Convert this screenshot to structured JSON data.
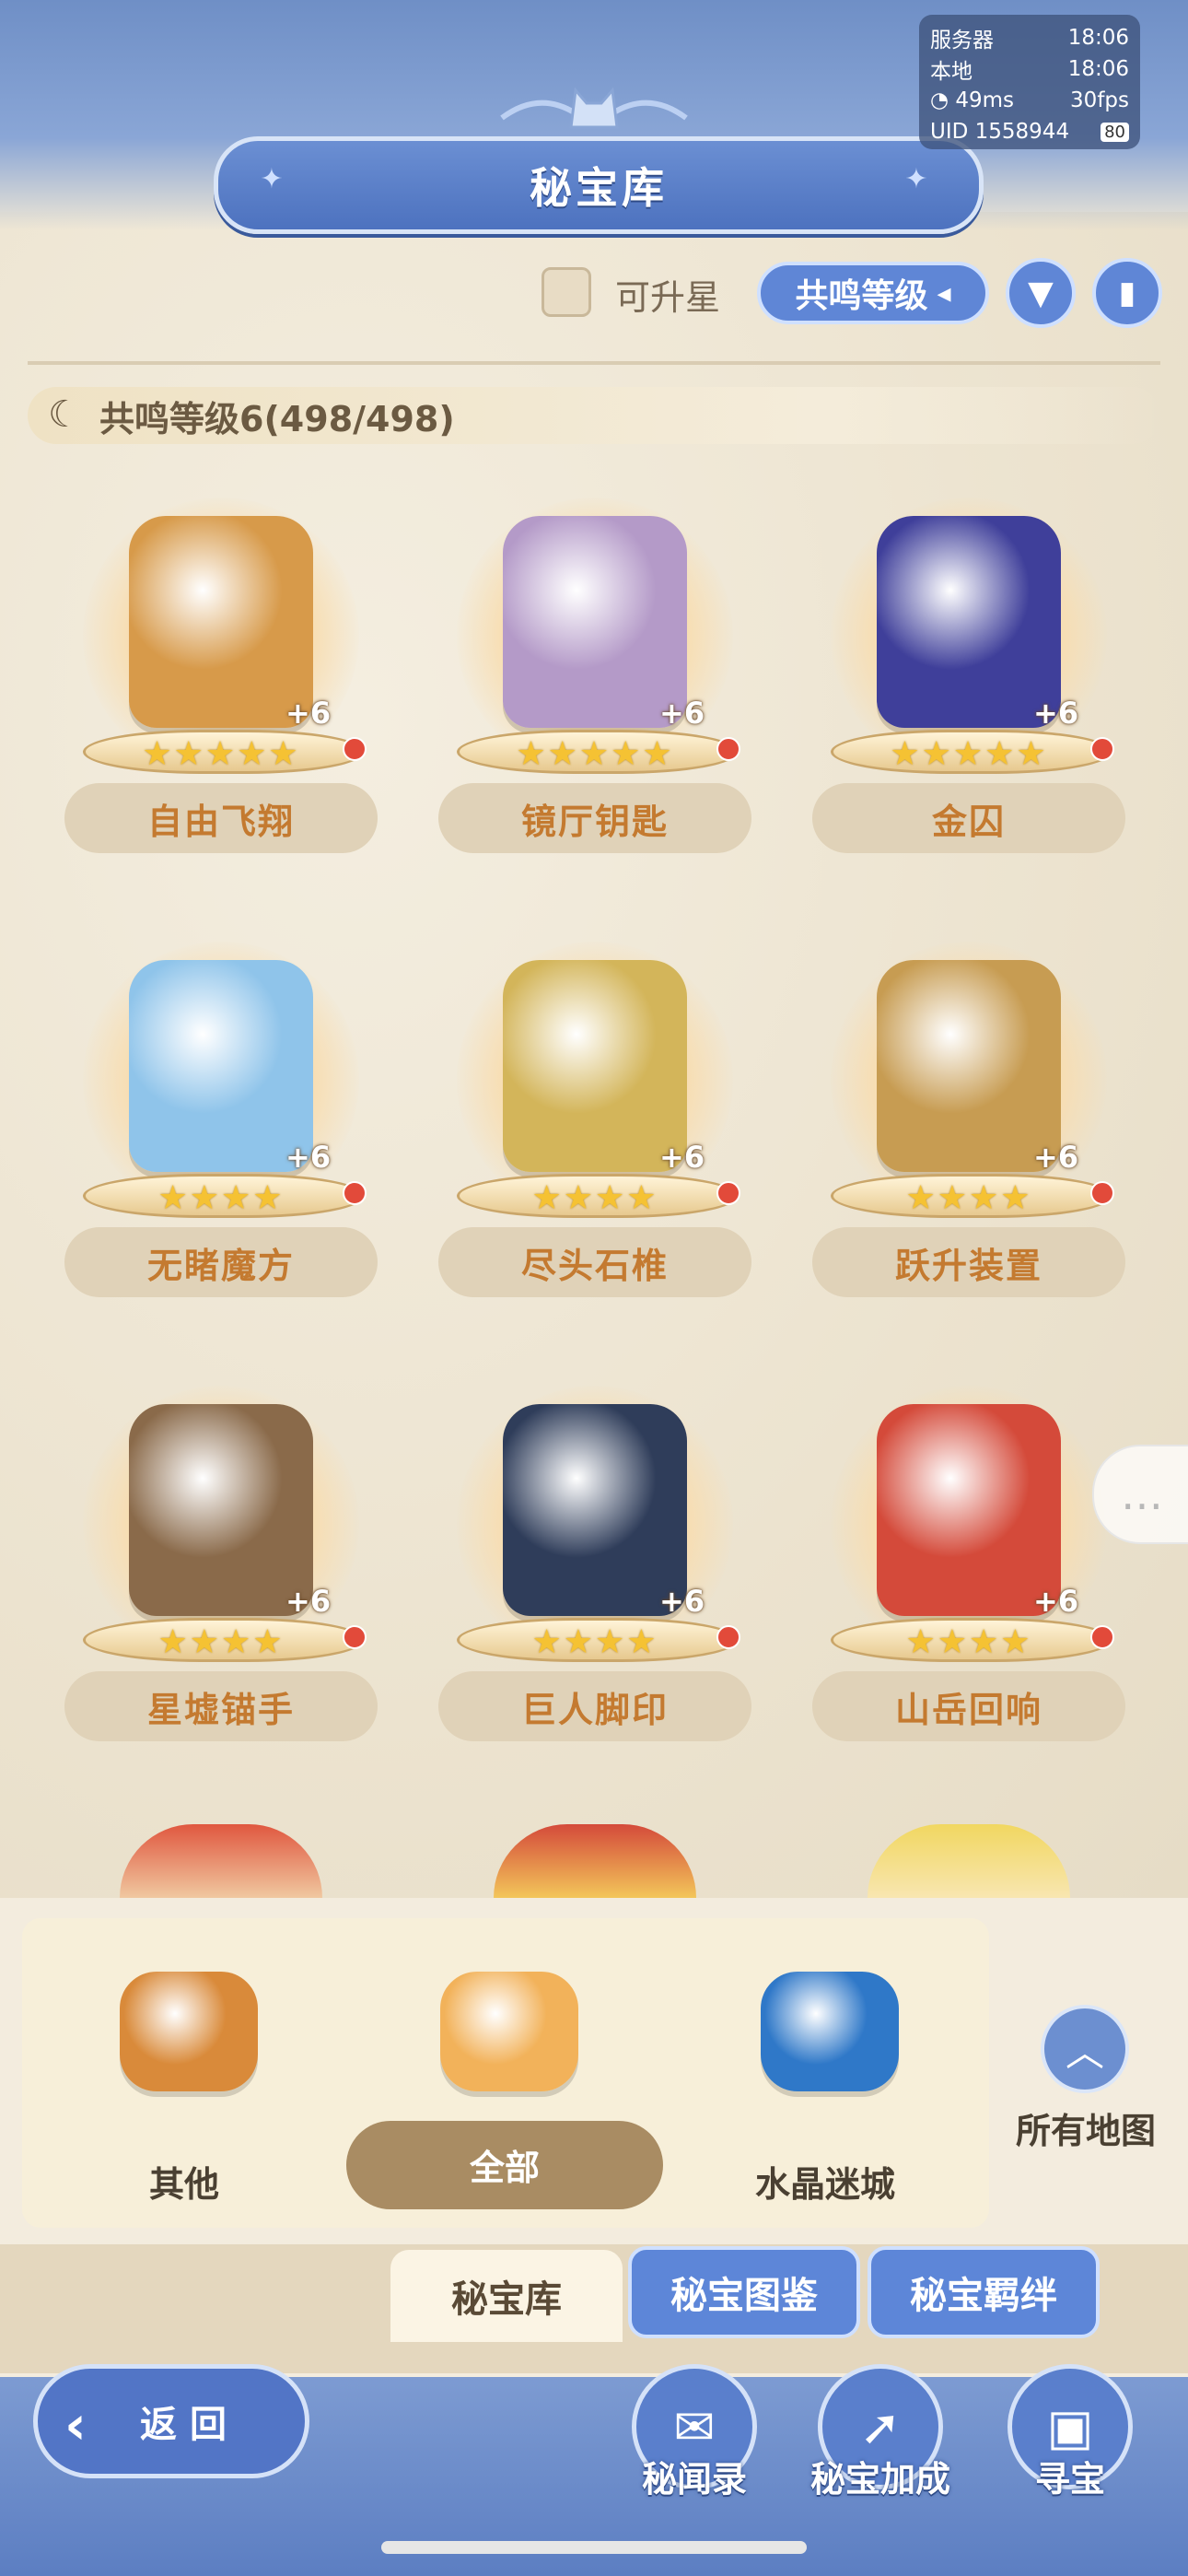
{
  "header": {
    "title": "秘宝库"
  },
  "status": {
    "server_label": "服务器",
    "server_time": "18:06",
    "local_label": "本地",
    "local_time": "18:06",
    "ping": "49ms",
    "fps": "30fps",
    "uid_label": "UID",
    "uid": "1558944",
    "battery": "80"
  },
  "toolbar": {
    "upgradable_label": "可升星",
    "sort_label": "共鸣等级"
  },
  "resonance": {
    "text": "共鸣等级6(498/498)"
  },
  "cards": [
    {
      "name": "自由飞翔",
      "plus": "+6",
      "stars": "★★★★★",
      "color": "#d79a4a"
    },
    {
      "name": "镜厅钥匙",
      "plus": "+6",
      "stars": "★★★★★",
      "color": "#b49ac8"
    },
    {
      "name": "金囚",
      "plus": "+6",
      "stars": "★★★★★",
      "color": "#3f3f9a"
    },
    {
      "name": "无睹魔方",
      "plus": "+6",
      "stars": "★★★★",
      "color": "#8fc4ea"
    },
    {
      "name": "尽头石椎",
      "plus": "+6",
      "stars": "★★★★",
      "color": "#d3b55a"
    },
    {
      "name": "跃升装置",
      "plus": "+6",
      "stars": "★★★★",
      "color": "#c79c52"
    },
    {
      "name": "星墟锚手",
      "plus": "+6",
      "stars": "★★★★",
      "color": "#8a6a4a"
    },
    {
      "name": "巨人脚印",
      "plus": "+6",
      "stars": "★★★★",
      "color": "#2f3d5a"
    },
    {
      "name": "山岳回响",
      "plus": "+6",
      "stars": "★★★★",
      "color": "#d44a3a"
    }
  ],
  "regions": [
    {
      "label": "其他",
      "color": "#d98a3a"
    },
    {
      "label": "全部",
      "color": "#f2b25a"
    },
    {
      "label": "水晶迷城",
      "color": "#2f78c8"
    }
  ],
  "all_maps_label": "所有地图",
  "tabs": {
    "library": "秘宝库",
    "catalog": "秘宝图鉴",
    "bonds": "秘宝羁绊"
  },
  "nav": {
    "back": "返回",
    "secrets": "秘闻录",
    "bonus": "秘宝加成",
    "hunt": "寻宝"
  }
}
